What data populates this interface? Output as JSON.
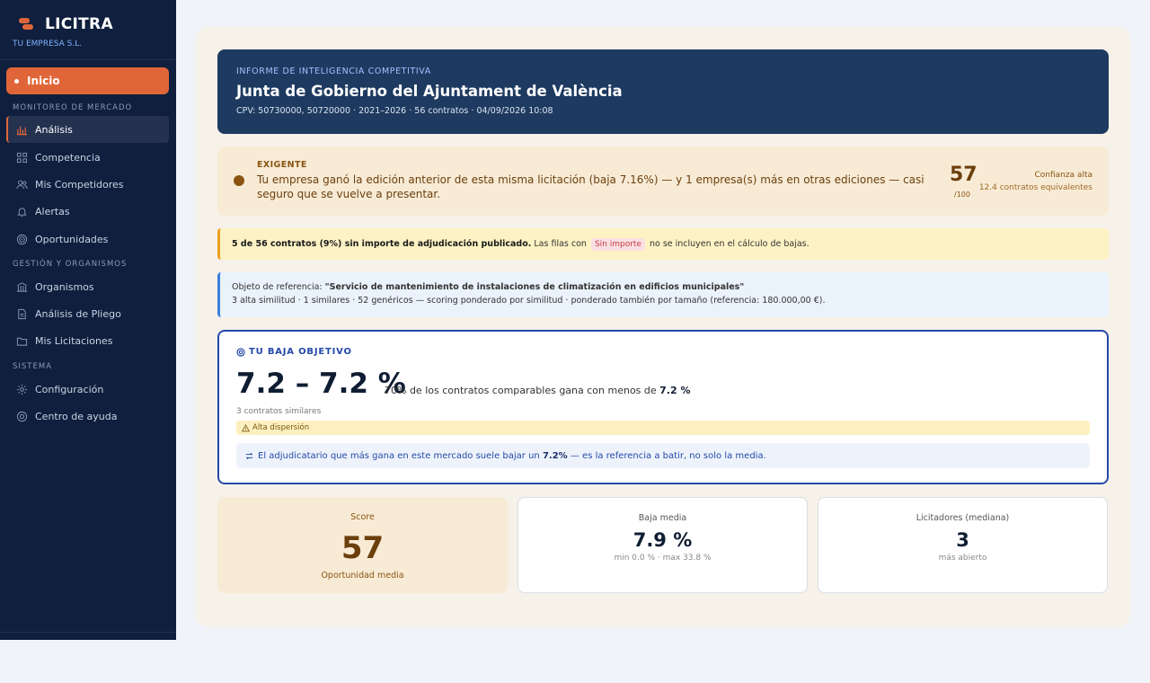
{
  "app": {
    "name": "LICITRA",
    "company": "TU EMPRESA S.L."
  },
  "sidebar": {
    "home_label": "Inicio",
    "section_market": "MONITOREO DE MERCADO",
    "section_management": "GESTIÓN Y ORGANISMOS",
    "section_system": "SISTEMA",
    "items": [
      {
        "label": "Análisis",
        "icon": "bar-chart-icon"
      },
      {
        "label": "Competencia",
        "icon": "grid-icon"
      },
      {
        "label": "Mis Competidores",
        "icon": "users-icon"
      },
      {
        "label": "Alertas",
        "icon": "bell-icon"
      },
      {
        "label": "Oportunidades",
        "icon": "target-icon"
      },
      {
        "label": "Organismos",
        "icon": "building-icon"
      },
      {
        "label": "Análisis de Pliego",
        "icon": "document-icon"
      },
      {
        "label": "Mis Licitaciones",
        "icon": "folder-icon"
      },
      {
        "label": "Configuración",
        "icon": "gear-icon"
      },
      {
        "label": "Centro de ayuda",
        "icon": "help-icon"
      }
    ]
  },
  "report": {
    "kicker": "INFORME DE INTELIGENCIA COMPETITIVA",
    "title": "Junta de Gobierno del Ajuntament de València",
    "meta": "CPV: 50730000, 50720000 · 2021–2026 · 56 contratos · 04/09/2026 10:08"
  },
  "alert": {
    "tag": "EXIGENTE",
    "text": "Tu empresa ganó la edición anterior de esta misma licitación (baja 7.16%) — y 1 empresa(s) más en otras ediciones — casi seguro que se vuelve a presentar.",
    "score": "57",
    "score_max": "/100",
    "confidence": "Confianza alta",
    "equivalent": "12.4 contratos equivalentes"
  },
  "warning": {
    "bold": "5 de 56 contratos (9%) sin importe de adjudicación publicado.",
    "before_pill": "Las filas con",
    "pill": "Sin importe",
    "after_pill": "no se incluyen en el cálculo de bajas."
  },
  "reference": {
    "label": "Objeto de referencia:",
    "object": "\"Servicio de mantenimiento de instalaciones de climatización en edificios municipales\"",
    "detail": "3 alta similitud · 1 similares · 52 genéricos — scoring ponderado por similitud · ponderado también por tamaño (referencia: 180.000,00 €)."
  },
  "target": {
    "heading": "TU BAJA OBJETIVO",
    "range": "7.2 – 7.2 %",
    "desc_prefix": "70% de los contratos comparables gana con menos de",
    "desc_value": "7.2 %",
    "similar": "3 contratos similares",
    "dispersion": "Alta dispersión",
    "note_prefix": "El adjudicatario que más gana en este mercado suele bajar un",
    "note_value": "7.2%",
    "note_suffix": "— es la referencia a batir, no solo la media."
  },
  "cards": [
    {
      "label": "Score",
      "value": "57",
      "sub": "Oportunidad media"
    },
    {
      "label": "Baja media",
      "value": "7.9 %",
      "sub": "min 0.0 % · max 33.8 %"
    },
    {
      "label": "Licitadores (mediana)",
      "value": "3",
      "sub": "más abierto"
    }
  ],
  "colors": {
    "sidebar": "#0f1f3d",
    "accent": "#e0663a",
    "hero": "#1e3a60",
    "target_border": "#2449a8",
    "warning_border": "#e8a21f",
    "info_border": "#3b7fdb"
  }
}
